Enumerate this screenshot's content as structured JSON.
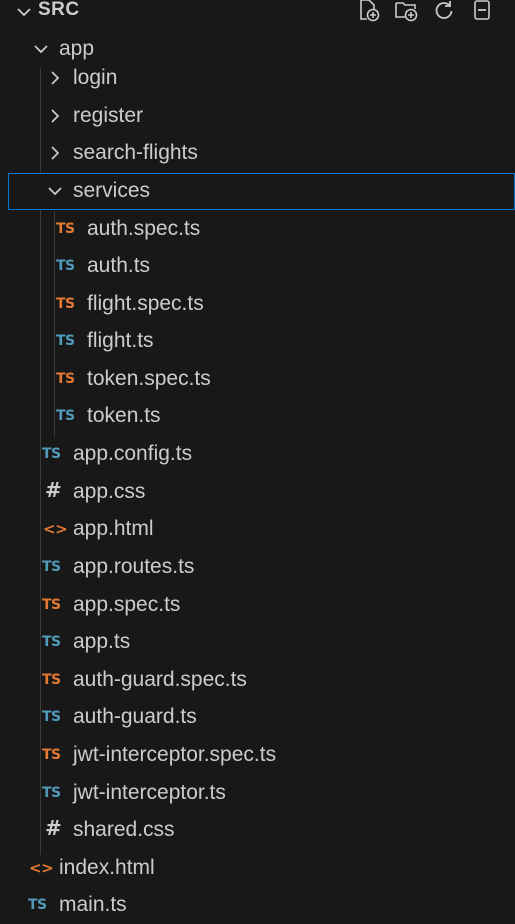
{
  "header": {
    "title": "SRC",
    "actions": [
      "new-file-icon",
      "new-folder-icon",
      "refresh-icon",
      "collapse-all-icon"
    ]
  },
  "tree": {
    "app": {
      "label": "app",
      "expanded": true
    },
    "login": {
      "label": "login",
      "expanded": false
    },
    "register": {
      "label": "register",
      "expanded": false
    },
    "search_flights": {
      "label": "search-flights",
      "expanded": false
    },
    "services": {
      "label": "services",
      "expanded": true,
      "selected": true
    },
    "services_files": [
      {
        "icon": "TS",
        "icon_color": "#e37933",
        "label": "auth.spec.ts"
      },
      {
        "icon": "TS",
        "icon_color": "#519aba",
        "label": "auth.ts"
      },
      {
        "icon": "TS",
        "icon_color": "#e37933",
        "label": "flight.spec.ts"
      },
      {
        "icon": "TS",
        "icon_color": "#519aba",
        "label": "flight.ts"
      },
      {
        "icon": "TS",
        "icon_color": "#e37933",
        "label": "token.spec.ts"
      },
      {
        "icon": "TS",
        "icon_color": "#519aba",
        "label": "token.ts"
      }
    ],
    "app_files": [
      {
        "icon": "TS",
        "icon_color": "#519aba",
        "label": "app.config.ts"
      },
      {
        "icon": "#",
        "icon_color": "#cccccc",
        "label": "app.css"
      },
      {
        "icon": "<>",
        "icon_color": "#e37933",
        "label": "app.html"
      },
      {
        "icon": "TS",
        "icon_color": "#519aba",
        "label": "app.routes.ts"
      },
      {
        "icon": "TS",
        "icon_color": "#e37933",
        "label": "app.spec.ts"
      },
      {
        "icon": "TS",
        "icon_color": "#519aba",
        "label": "app.ts"
      },
      {
        "icon": "TS",
        "icon_color": "#e37933",
        "label": "auth-guard.spec.ts"
      },
      {
        "icon": "TS",
        "icon_color": "#519aba",
        "label": "auth-guard.ts"
      },
      {
        "icon": "TS",
        "icon_color": "#e37933",
        "label": "jwt-interceptor.spec.ts"
      },
      {
        "icon": "TS",
        "icon_color": "#519aba",
        "label": "jwt-interceptor.ts"
      },
      {
        "icon": "#",
        "icon_color": "#cccccc",
        "label": "shared.css"
      }
    ],
    "src_files": [
      {
        "icon": "<>",
        "icon_color": "#e37933",
        "label": "index.html"
      },
      {
        "icon": "TS",
        "icon_color": "#519aba",
        "label": "main.ts"
      }
    ]
  },
  "colors": {
    "background": "#181818",
    "text": "#cccccc",
    "selection_border": "#0078d4",
    "ts_blue": "#519aba",
    "ts_orange": "#e37933",
    "indent_guide": "#3b3b3b"
  }
}
